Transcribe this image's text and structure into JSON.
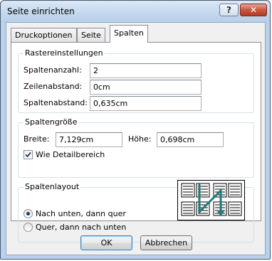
{
  "window": {
    "title": "Seite einrichten"
  },
  "titlebar": {
    "help_glyph": "?",
    "close_glyph": "✕"
  },
  "tabs": [
    {
      "label": "Druckoptionen",
      "active": false
    },
    {
      "label": "Seite",
      "active": false
    },
    {
      "label": "Spalten",
      "active": true
    }
  ],
  "raster": {
    "legend": "Rastereinstellungen",
    "columns_label": "Spaltenanzahl:",
    "columns_value": "2",
    "row_spacing_label": "Zeilenabstand:",
    "row_spacing_value": "0cm",
    "column_spacing_label": "Spaltenabstand:",
    "column_spacing_value": "0,635cm"
  },
  "size": {
    "legend": "Spaltengröße",
    "width_label": "Breite:",
    "width_value": "7,129cm",
    "height_label": "Höhe:",
    "height_value": "0,698cm",
    "same_as_detail_label": "Wie Detailbereich",
    "same_as_detail_checked": true
  },
  "layout": {
    "legend": "Spaltenlayout",
    "option_down_then_across": "Nach unten, dann quer",
    "option_across_then_down": "Quer, dann nach unten",
    "selected": "down_then_across"
  },
  "buttons": {
    "ok": "OK",
    "cancel": "Abbrechen"
  },
  "colors": {
    "preview_arrow": "#1f7a7a",
    "titlebar": "#c3d8ee",
    "close_button": "#c75a42"
  }
}
